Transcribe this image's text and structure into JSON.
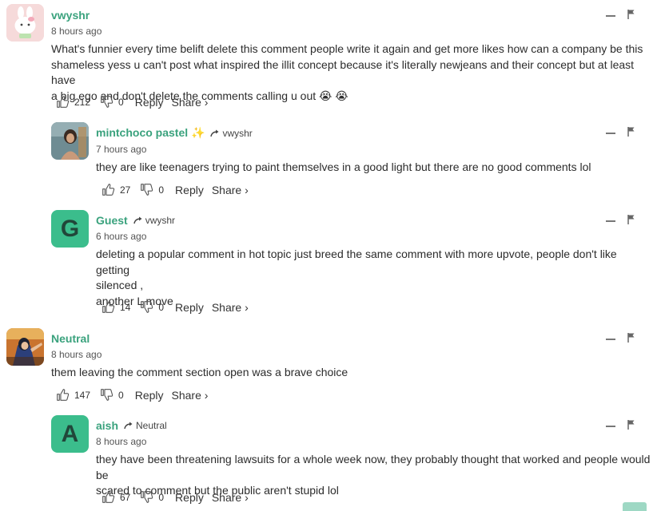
{
  "comments": [
    {
      "author": "vwyshr",
      "avatar_colors": {
        "bg": "#f8dede",
        "fg": "#ffffff"
      },
      "time": "8 hours ago",
      "lines": [
        "What's funnier every time belift delete this comment people write it again and get more likes how can a company be this",
        "shameless yess u can't post what inspired the illit concept because it's literally newjeans and their concept but at least have",
        "a big ego and don't delete the comments calling u out 😭 😭"
      ],
      "likes": "212",
      "dislikes": "0",
      "reply": "Reply",
      "share": "Share ›"
    },
    {
      "author": "mintchoco pastel ✨",
      "reply_to": "vwyshr",
      "avatar_colors": {
        "bg": "#7d8f8a"
      },
      "time": "7 hours ago",
      "lines": [
        "they are like teenagers trying to paint themselves in a good light but there are no good comments lol"
      ],
      "likes": "27",
      "dislikes": "0",
      "reply": "Reply",
      "share": "Share ›"
    },
    {
      "author": "Guest",
      "reply_to": "vwyshr",
      "avatar_letter": "G",
      "avatar_colors": {
        "bg": "#3bbd8c"
      },
      "time": "6 hours ago",
      "lines": [
        "deleting a popular comment in hot topic just breed the same comment with more upvote, people don't like getting",
        "silenced ,",
        "another L move"
      ],
      "likes": "14",
      "dislikes": "0",
      "reply": "Reply",
      "share": "Share ›"
    },
    {
      "author": "Neutral",
      "avatar_colors": {
        "bg": "#b0622a"
      },
      "time": "8 hours ago",
      "lines": [
        "them leaving the comment section open was a brave choice"
      ],
      "likes": "147",
      "dislikes": "0",
      "reply": "Reply",
      "share": "Share ›"
    },
    {
      "author": "aish",
      "reply_to": "Neutral",
      "avatar_letter": "A",
      "avatar_colors": {
        "bg": "#3bbd8c"
      },
      "time": "8 hours ago",
      "lines": [
        "they have been threatening lawsuits for a whole week now, they probably thought that worked and people would be",
        "scared to comment but the public aren't stupid lol"
      ],
      "likes": "67",
      "dislikes": "0",
      "reply": "Reply",
      "share": "Share ›"
    }
  ]
}
